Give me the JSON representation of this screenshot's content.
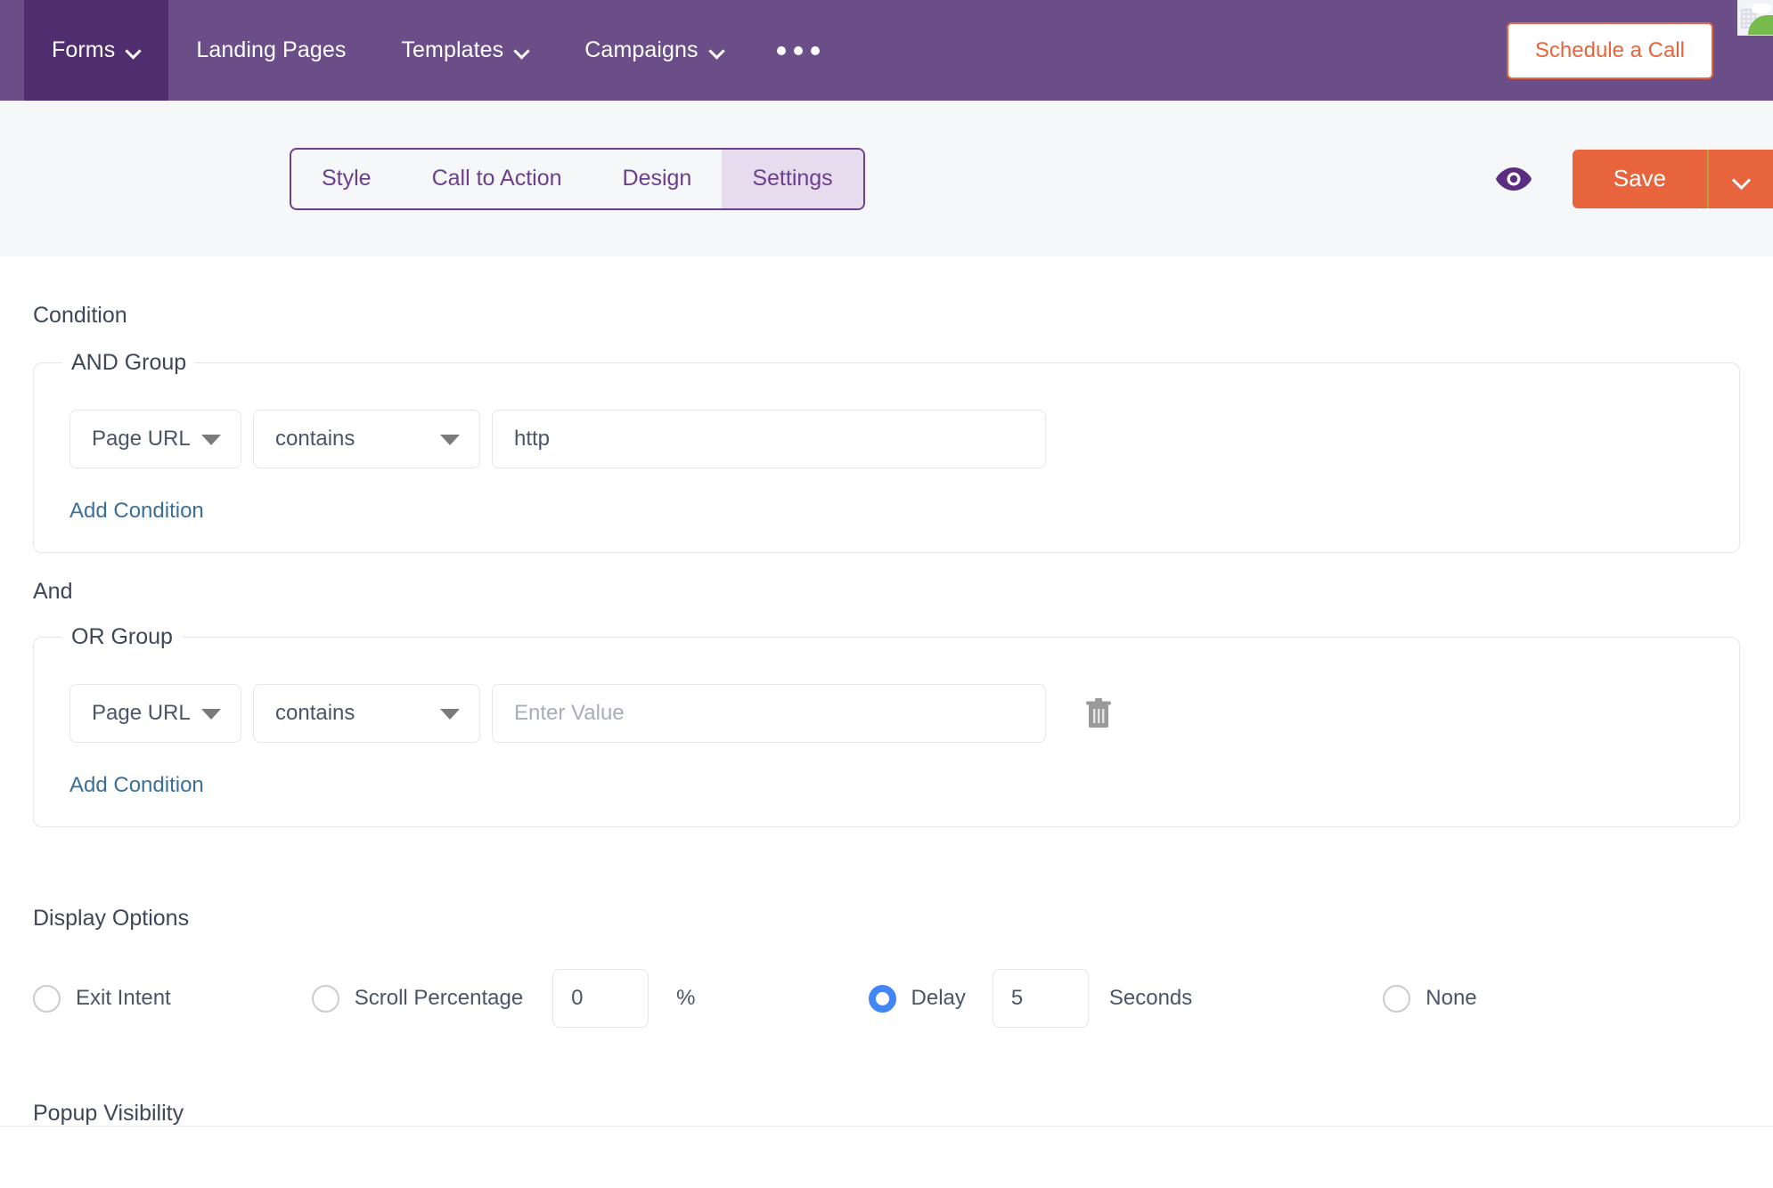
{
  "topnav": {
    "background_color": "#6b4e87",
    "active_background_color": "#4f2d6e",
    "items": [
      {
        "label": "Forms",
        "has_caret": true,
        "active": true
      },
      {
        "label": "Landing Pages",
        "has_caret": false,
        "active": false
      },
      {
        "label": "Templates",
        "has_caret": true,
        "active": false
      },
      {
        "label": "Campaigns",
        "has_caret": true,
        "active": false
      }
    ],
    "more_icon": "ellipsis-horizontal-icon",
    "cta": {
      "label": "Schedule a Call",
      "text_color": "#e8643c",
      "border_color": "#e8643c"
    }
  },
  "toolbar": {
    "background_color": "#f5f7f9",
    "accent_color": "#6b3f8e",
    "tabs": [
      {
        "label": "Style",
        "active": false
      },
      {
        "label": "Call to Action",
        "active": false
      },
      {
        "label": "Design",
        "active": false
      },
      {
        "label": "Settings",
        "active": true
      }
    ],
    "preview_icon": "eye-icon",
    "save_label": "Save",
    "save_color": "#e8643c",
    "save_caret_icon": "chevron-down-icon"
  },
  "condition": {
    "title": "Condition",
    "conjunction": "And",
    "groups": [
      {
        "legend": "AND Group",
        "field": "Page URL",
        "operator": "contains",
        "value": "http",
        "placeholder": "Enter Value",
        "add_condition_label": "Add Condition",
        "has_delete": false
      },
      {
        "legend": "OR Group",
        "field": "Page URL",
        "operator": "contains",
        "value": "",
        "placeholder": "Enter Value",
        "add_condition_label": "Add Condition",
        "has_delete": true,
        "delete_icon": "trash-icon"
      }
    ]
  },
  "display_options": {
    "title": "Display Options",
    "selected": "Delay",
    "options": [
      {
        "label": "Exit Intent",
        "checked": false
      },
      {
        "label": "Scroll Percentage",
        "checked": false
      },
      {
        "label": "Delay",
        "checked": true
      },
      {
        "label": "None",
        "checked": false
      }
    ],
    "scroll_percentage_value": "0",
    "scroll_percentage_unit": "%",
    "delay_value": "5",
    "delay_unit": "Seconds",
    "radio_checked_color": "#4285f4"
  },
  "popup_visibility": {
    "title": "Popup Visibility"
  }
}
